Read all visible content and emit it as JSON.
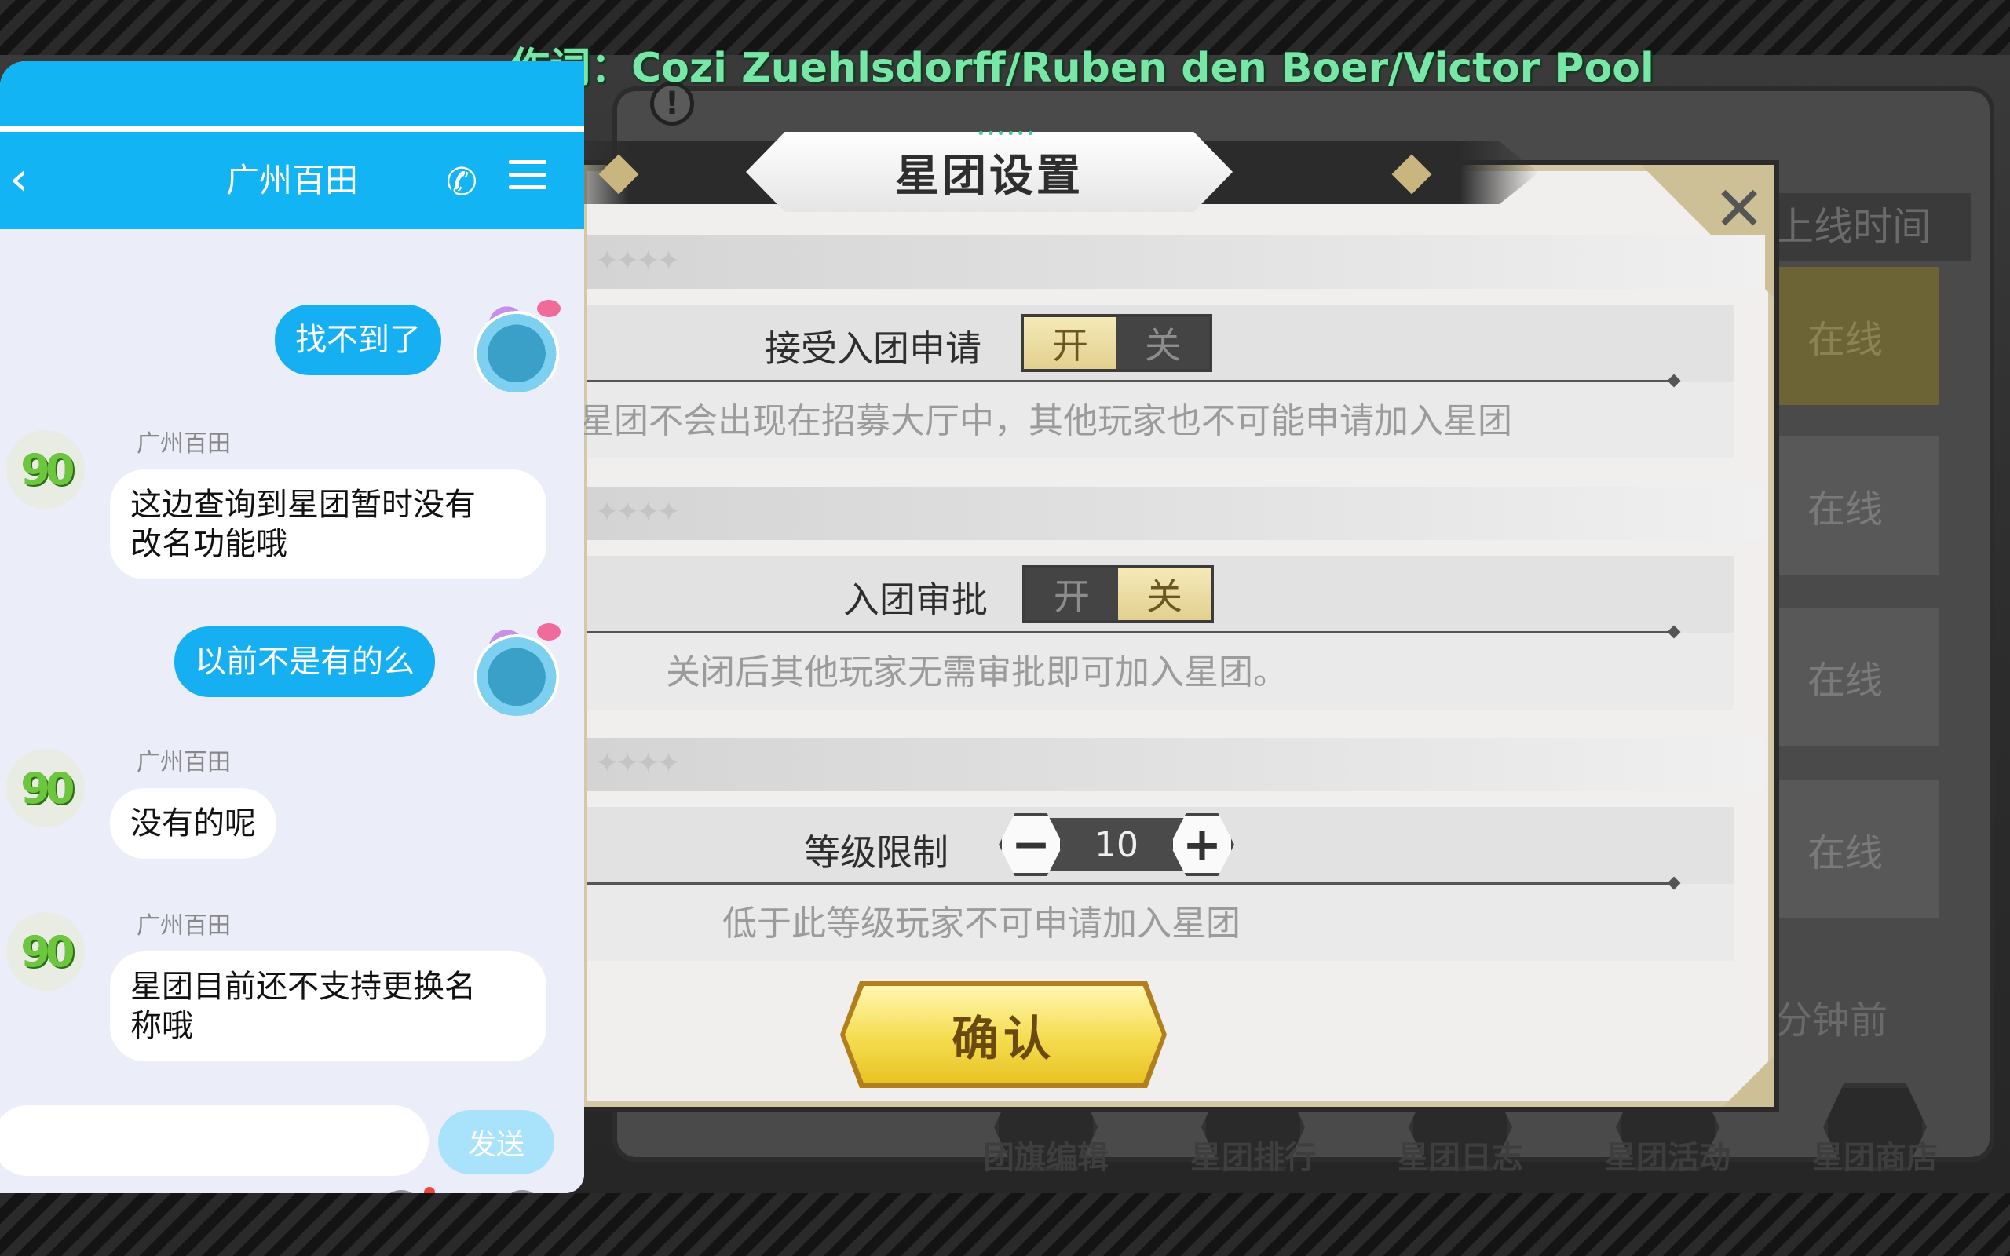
{
  "lyric": "作词：Cozi Zuehlsdorff/Ruben den Boer/Victor Pool",
  "game": {
    "dialog_title": "星团设置",
    "settings": [
      {
        "label": "接受入团申请",
        "on_label": "开",
        "off_label": "关",
        "value": "开",
        "desc": "星团不会出现在招募大厅中，其他玩家也不可能申请加入星团"
      },
      {
        "label": "入团审批",
        "on_label": "开",
        "off_label": "关",
        "value": "关",
        "desc": "关闭后其他玩家无需审批即可加入星团。"
      },
      {
        "label": "等级限制",
        "value": "10",
        "minus": "−",
        "plus": "+",
        "desc": "低于此等级玩家不可申请加入星团"
      }
    ],
    "confirm_label": "确认",
    "online_header": "上线时间",
    "online_rows": [
      "在线",
      "在线",
      "在线",
      "在线"
    ],
    "last_seen": "分钟前",
    "bottom_tabs": [
      "团旗编辑",
      "星团排行",
      "星团日志",
      "星团活动",
      "星团商店"
    ],
    "close_symbol": "✕"
  },
  "chat": {
    "title": "广州百田",
    "icons": {
      "back": "back-arrow-icon",
      "phone": "phone-icon",
      "menu": "menu-icon"
    },
    "messages": [
      {
        "from": "self",
        "text": "找不到了"
      },
      {
        "from": "agent",
        "name": "广州百田",
        "text": "这边查询到星团暂时没有\n改名功能哦"
      },
      {
        "from": "self",
        "text": "以前不是有的么"
      },
      {
        "from": "agent",
        "name": "广州百田",
        "text": "没有的呢"
      },
      {
        "from": "agent",
        "name": "广州百田",
        "text": "星团目前还不支持更换名\n称哦"
      }
    ],
    "agent_avatar_text": "90",
    "input_value": "",
    "send_label": "发送",
    "toolbar": [
      "mic-icon",
      "image-icon",
      "camera-icon",
      "emoji-icon",
      "plus-icon"
    ],
    "colors": {
      "header": "#13b4f3",
      "bubble_out": "#16b0f2",
      "background": "#ebedf8"
    }
  }
}
